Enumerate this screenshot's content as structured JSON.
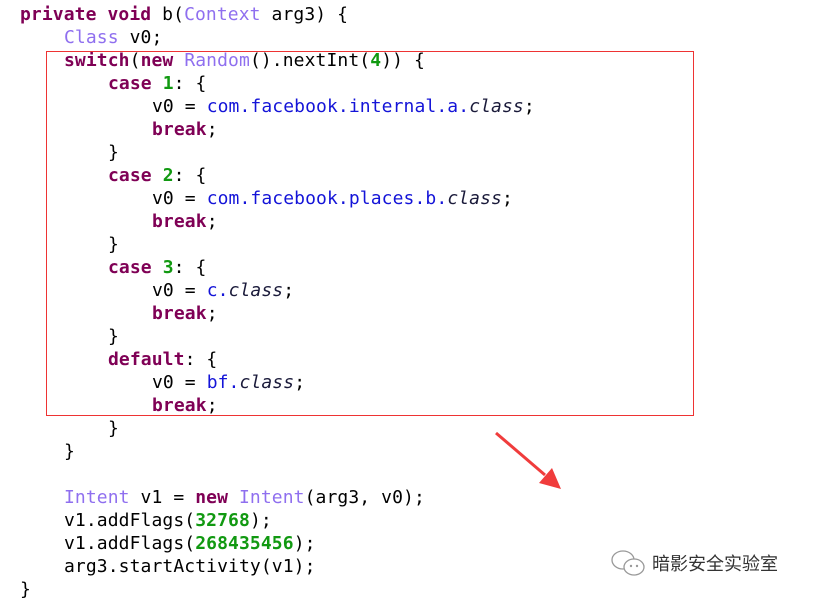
{
  "colors": {
    "keyword": "#7f0055",
    "type": "#8f6fef",
    "number": "#119911",
    "package": "#1414d8",
    "highlight": "#ee3333"
  },
  "lines": [
    {
      "indent": 0,
      "tokens": [
        [
          "private",
          "kw"
        ],
        [
          " ",
          "plain"
        ],
        [
          "void",
          "kw"
        ],
        [
          " b(",
          "plain"
        ],
        [
          "Context",
          "type"
        ],
        [
          " arg3) {",
          "plain"
        ]
      ]
    },
    {
      "indent": 1,
      "tokens": [
        [
          "Class",
          "type"
        ],
        [
          " v0;",
          "plain"
        ]
      ]
    },
    {
      "indent": 1,
      "tokens": [
        [
          "switch",
          "kw"
        ],
        [
          "(",
          "plain"
        ],
        [
          "new",
          "kw"
        ],
        [
          " ",
          "plain"
        ],
        [
          "Random",
          "type"
        ],
        [
          "().nextInt(",
          "plain"
        ],
        [
          "4",
          "num"
        ],
        [
          ")) {",
          "plain"
        ]
      ]
    },
    {
      "indent": 2,
      "tokens": [
        [
          "case",
          "kw"
        ],
        [
          " ",
          "plain"
        ],
        [
          "1",
          "num"
        ],
        [
          ": {",
          "plain"
        ]
      ]
    },
    {
      "indent": 3,
      "tokens": [
        [
          "v0 = ",
          "plain"
        ],
        [
          "com.facebook.internal.a.",
          "pkg"
        ],
        [
          "class",
          "it"
        ],
        [
          ";",
          "plain"
        ]
      ]
    },
    {
      "indent": 3,
      "tokens": [
        [
          "break",
          "kw"
        ],
        [
          ";",
          "plain"
        ]
      ]
    },
    {
      "indent": 2,
      "tokens": [
        [
          "}",
          "plain"
        ]
      ]
    },
    {
      "indent": 2,
      "tokens": [
        [
          "case",
          "kw"
        ],
        [
          " ",
          "plain"
        ],
        [
          "2",
          "num"
        ],
        [
          ": {",
          "plain"
        ]
      ]
    },
    {
      "indent": 3,
      "tokens": [
        [
          "v0 = ",
          "plain"
        ],
        [
          "com.facebook.places.b.",
          "pkg"
        ],
        [
          "class",
          "it"
        ],
        [
          ";",
          "plain"
        ]
      ]
    },
    {
      "indent": 3,
      "tokens": [
        [
          "break",
          "kw"
        ],
        [
          ";",
          "plain"
        ]
      ]
    },
    {
      "indent": 2,
      "tokens": [
        [
          "}",
          "plain"
        ]
      ]
    },
    {
      "indent": 2,
      "tokens": [
        [
          "case",
          "kw"
        ],
        [
          " ",
          "plain"
        ],
        [
          "3",
          "num"
        ],
        [
          ": {",
          "plain"
        ]
      ]
    },
    {
      "indent": 3,
      "tokens": [
        [
          "v0 = ",
          "plain"
        ],
        [
          "c.",
          "pkg"
        ],
        [
          "class",
          "it"
        ],
        [
          ";",
          "plain"
        ]
      ]
    },
    {
      "indent": 3,
      "tokens": [
        [
          "break",
          "kw"
        ],
        [
          ";",
          "plain"
        ]
      ]
    },
    {
      "indent": 2,
      "tokens": [
        [
          "}",
          "plain"
        ]
      ]
    },
    {
      "indent": 2,
      "tokens": [
        [
          "default",
          "kw"
        ],
        [
          ": {",
          "plain"
        ]
      ]
    },
    {
      "indent": 3,
      "tokens": [
        [
          "v0 = ",
          "plain"
        ],
        [
          "bf.",
          "pkg"
        ],
        [
          "class",
          "it"
        ],
        [
          ";",
          "plain"
        ]
      ]
    },
    {
      "indent": 3,
      "tokens": [
        [
          "break",
          "kw"
        ],
        [
          ";",
          "plain"
        ]
      ]
    },
    {
      "indent": 2,
      "tokens": [
        [
          "}",
          "plain"
        ]
      ]
    },
    {
      "indent": 1,
      "tokens": [
        [
          "}",
          "plain"
        ]
      ]
    },
    {
      "indent": 0,
      "tokens": []
    },
    {
      "indent": 1,
      "tokens": [
        [
          "Intent",
          "type"
        ],
        [
          " v1 = ",
          "plain"
        ],
        [
          "new",
          "kw"
        ],
        [
          " ",
          "plain"
        ],
        [
          "Intent",
          "type"
        ],
        [
          "(arg3, v0);",
          "plain"
        ]
      ]
    },
    {
      "indent": 1,
      "tokens": [
        [
          "v1.addFlags(",
          "plain"
        ],
        [
          "32768",
          "num"
        ],
        [
          ");",
          "plain"
        ]
      ]
    },
    {
      "indent": 1,
      "tokens": [
        [
          "v1.addFlags(",
          "plain"
        ],
        [
          "268435456",
          "num"
        ],
        [
          ");",
          "plain"
        ]
      ]
    },
    {
      "indent": 1,
      "tokens": [
        [
          "arg3.startActivity(v1);",
          "plain"
        ]
      ]
    },
    {
      "indent": 0,
      "tokens": [
        [
          "}",
          "plain"
        ]
      ]
    }
  ],
  "watermark": {
    "icon": "wechat-icon",
    "text": "暗影安全实验室"
  }
}
